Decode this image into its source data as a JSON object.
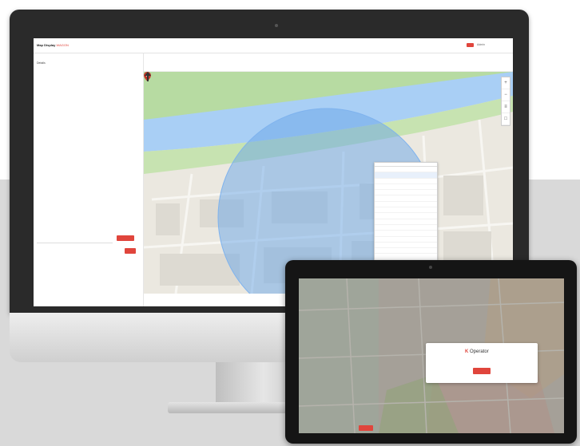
{
  "app": {
    "title": "Map Display",
    "subtitle": "WAGON",
    "header_user": "Admin"
  },
  "sidebar": {
    "section_label": "Details",
    "description": "",
    "search_value": "",
    "search_button": "",
    "result_text": "",
    "result_meta": "",
    "result_button": ""
  },
  "toolbar": {
    "items": [
      {
        "label": "",
        "active": false
      },
      {
        "label": "",
        "active": false
      },
      {
        "label": "",
        "active": true
      },
      {
        "label": "",
        "active": false
      }
    ]
  },
  "popup": {
    "title": "",
    "items": [
      "",
      "",
      "",
      "",
      "",
      "",
      "",
      "",
      "",
      "",
      "",
      "",
      "",
      "",
      "",
      "",
      "",
      "",
      "",
      "",
      "",
      "",
      ""
    ],
    "selected_index": 1
  },
  "map_status": "",
  "tablet": {
    "modal_logo": "Operator",
    "modal_text": "",
    "modal_button": "",
    "footer_button": "",
    "footer_left": "",
    "footer_right": ""
  },
  "colors": {
    "accent": "#e0453c",
    "river": "#a9cff5",
    "park": "#b7dba2",
    "radius_fill": "#6aa6e8"
  }
}
